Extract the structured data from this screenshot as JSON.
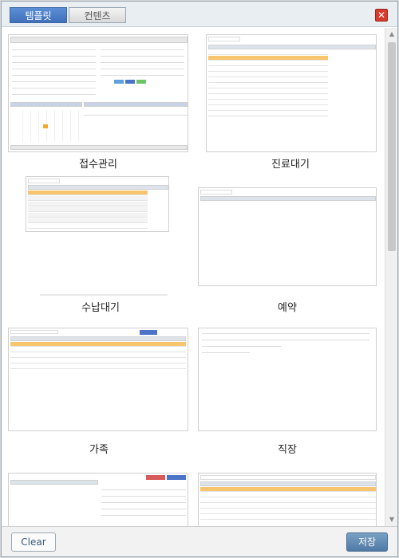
{
  "tabs": [
    {
      "label": "템플릿",
      "active": true
    },
    {
      "label": "컨텐츠",
      "active": false
    }
  ],
  "close_label": "✕",
  "templates": [
    {
      "label": "접수관리"
    },
    {
      "label": "진료대기"
    },
    {
      "label": "수납대기"
    },
    {
      "label": "예약"
    },
    {
      "label": "가족"
    },
    {
      "label": "직장"
    }
  ],
  "buttons": {
    "clear": "Clear",
    "save": "저장"
  },
  "colors": {
    "tab_active": "#4a7cc6",
    "highlight_row": "#f7c56e",
    "close": "#d83a2b",
    "save": "#5f89b3"
  }
}
